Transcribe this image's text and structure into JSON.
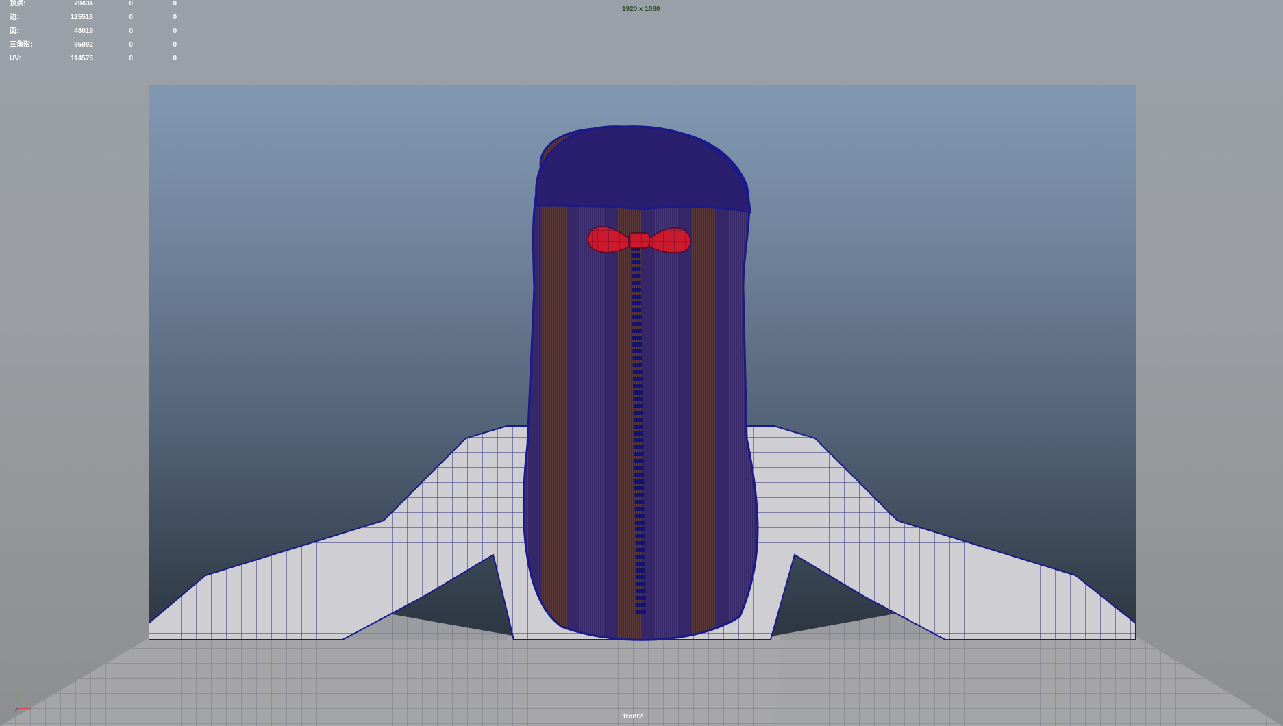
{
  "hud": {
    "rows": [
      {
        "label": "顶点:",
        "total": "79434",
        "selected": "0",
        "triangles": "0"
      },
      {
        "label": "边:",
        "total": "125516",
        "selected": "0",
        "triangles": "0"
      },
      {
        "label": "面:",
        "total": "48019",
        "selected": "0",
        "triangles": "0"
      },
      {
        "label": "三角形:",
        "total": "95992",
        "selected": "0",
        "triangles": "0"
      },
      {
        "label": "UV:",
        "total": "114575",
        "selected": "0",
        "triangles": "0"
      }
    ]
  },
  "resolution_gate_label": "1920 x 1080",
  "camera_name": "front2",
  "colors": {
    "wireframe": "#1a1a8a",
    "bow": "#c0182a",
    "hair_shade": "#6b3a1c",
    "body_shade": "#c8c8cc",
    "gate_top": "#8299b3",
    "gate_bottom": "#2c3540"
  },
  "icons": {
    "axis": "view-axis-icon"
  }
}
